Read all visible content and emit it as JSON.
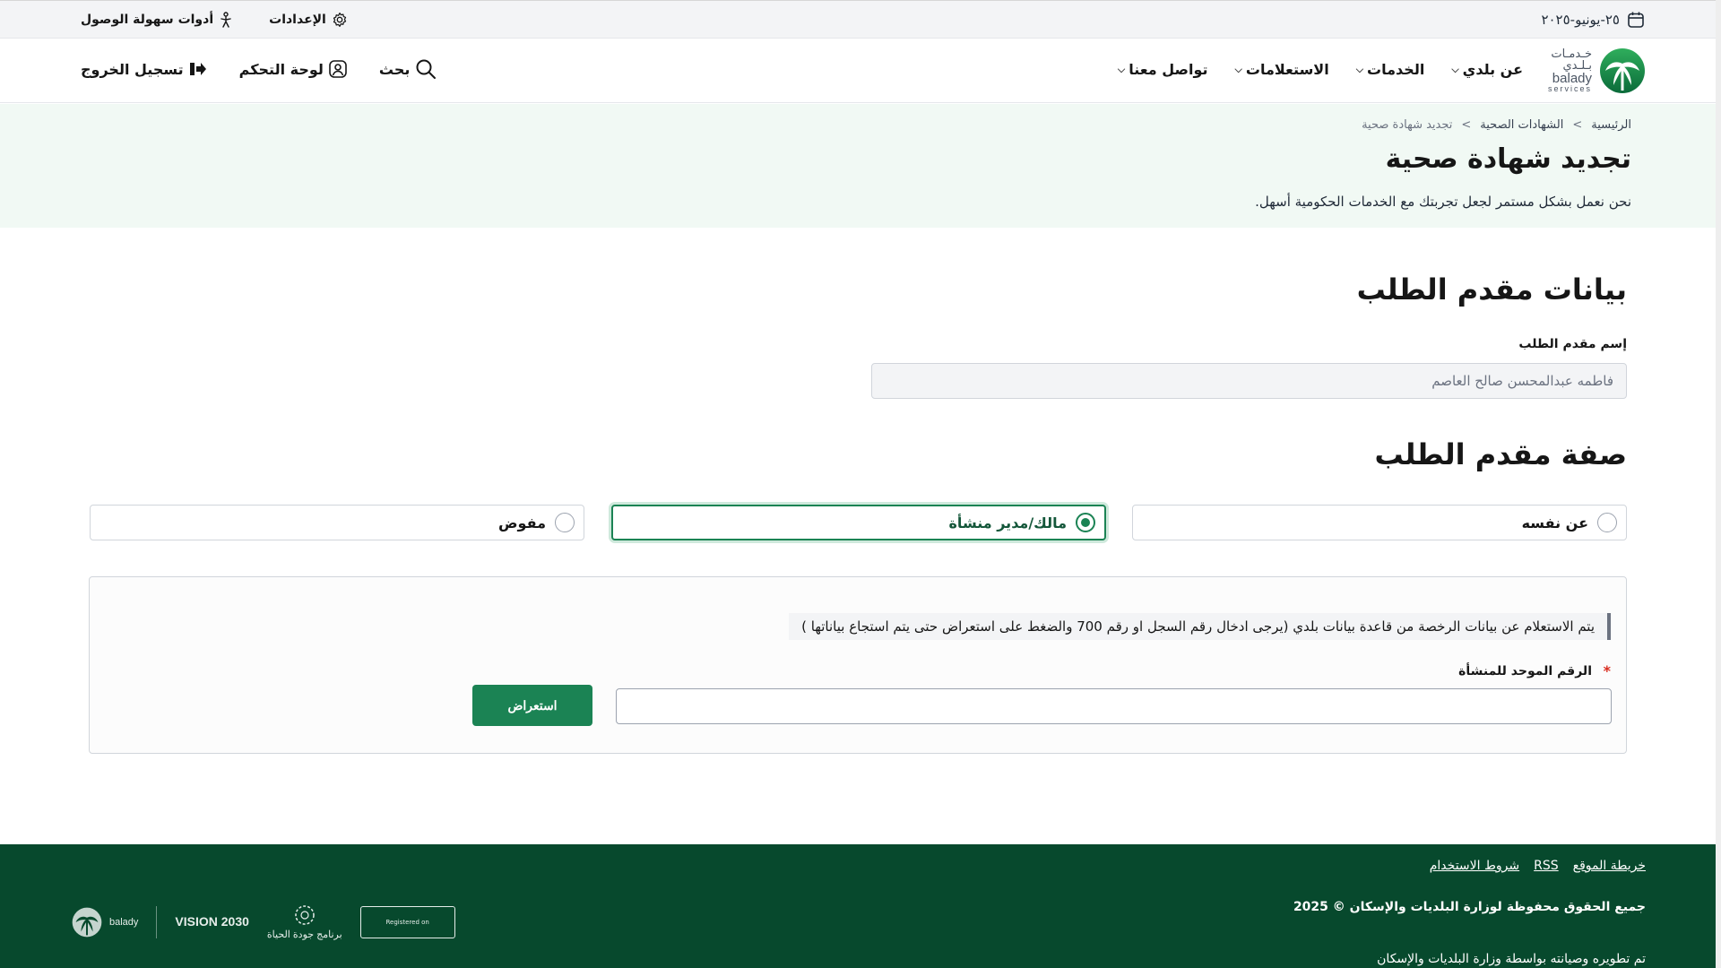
{
  "topbar": {
    "date": "٢٥-يونيو-٢٠٢٥",
    "settings_label": "الإعدادات",
    "accessibility_label": "أدوات سهولة الوصول"
  },
  "logo": {
    "ar": "خـدمـات",
    "ar_main": "بـلـدي",
    "en1": "balady",
    "en2": "services"
  },
  "nav": {
    "items": [
      {
        "label": "عن بلدي"
      },
      {
        "label": "الخدمات"
      },
      {
        "label": "الاستعلامات"
      },
      {
        "label": "تواصل معنا"
      }
    ],
    "search_label": "بحث",
    "dashboard_label": "لوحة التحكم",
    "logout_label": "تسجيل الخروج"
  },
  "hero": {
    "breadcrumbs": [
      "الرئيسية",
      "الشهادات الصحية",
      "تجديد شهادة صحية"
    ],
    "title": "تجديد شهادة صحية",
    "subtitle": "نحن نعمل بشكل مستمر لجعل تجربتك مع الخدمات الحكومية أسهل."
  },
  "applicant": {
    "section_title": "بيانات مقدم الطلب",
    "name_label": "إسم مقدم الطلب",
    "name_value": "فاطمه عبدالمحسن صالح العاصم"
  },
  "capacity": {
    "section_title": "صفة مقدم الطلب",
    "options": [
      {
        "label": "عن نفسه",
        "selected": false
      },
      {
        "label": "مالك/مدير منشأة",
        "selected": true
      },
      {
        "label": "مفوض",
        "selected": false
      }
    ]
  },
  "lookup": {
    "notice": "يتم الاستعلام عن بيانات الرخصة من قاعدة بيانات بلدي (يرجى ادخال رقم السجل او رقم 700 والضغط على استعراض حتى يتم استجاع بياناتها )",
    "field_label": "الرقم الموحد للمنشأة",
    "required_mark": "*",
    "field_value": "",
    "view_button": "استعراض"
  },
  "footer": {
    "links": [
      "خريطة الموقع",
      "RSS",
      "شروط الاستخدام"
    ],
    "copyright": "جميع الحقوق محفوظة لوزارة البلديات والإسكان © 2025",
    "developed_by": "تم تطويره وصيانته بواسطة وزارة البلديات والإسكان",
    "partners": {
      "balady": "balady",
      "vision": "VISION 2030",
      "quality": "برنامج جودة الحياة",
      "dga": "Registered on"
    }
  },
  "colors": {
    "primary": "#1b8354",
    "footer_bg": "#07492d",
    "hero_bg": "#f1f9f4"
  }
}
